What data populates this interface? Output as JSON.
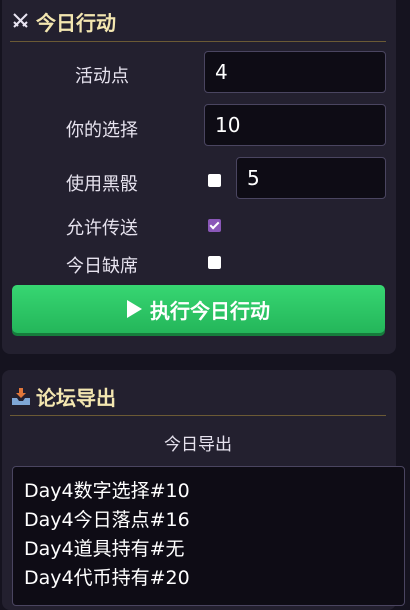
{
  "daily_action": {
    "title": "今日行动",
    "icon": "crossed-swords-icon",
    "fields": {
      "activity_points": {
        "label": "活动点",
        "value": "4"
      },
      "your_choice": {
        "label": "你的选择",
        "value": "10"
      },
      "black_dice": {
        "label": "使用黑骰",
        "checked": false,
        "value": "5"
      },
      "allow_teleport": {
        "label": "允许传送",
        "checked": true
      },
      "absent_today": {
        "label": "今日缺席",
        "checked": false
      }
    },
    "run_button_label": "执行今日行动",
    "run_button_icon": "play-icon",
    "button_color": "#2ecc6a"
  },
  "forum_export": {
    "title": "论坛导出",
    "icon": "inbox-tray-icon",
    "caption": "今日导出",
    "lines": [
      "Day4数字选择#10",
      "Day4今日落点#16",
      "Day4道具持有#无",
      "Day4代币持有#20"
    ]
  }
}
